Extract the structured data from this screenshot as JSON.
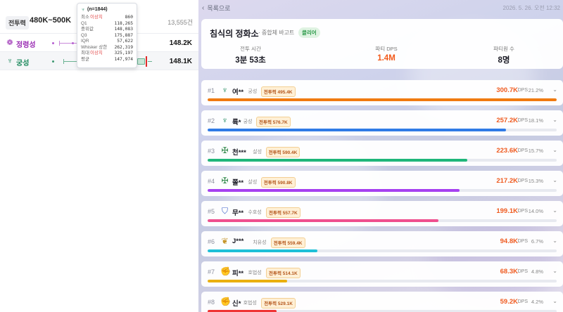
{
  "left": {
    "filter": {
      "chip": "전투력",
      "range": "480K~500K",
      "count": "13,555건"
    },
    "classes": [
      {
        "name": "정령성",
        "icon": "spirit-icon",
        "value": "148.2K",
        "color": "#9b2fb4"
      },
      {
        "name": "궁성",
        "icon": "bow-icon",
        "value": "148.1K",
        "color": "#1f8a5e"
      }
    ],
    "tooltip": {
      "header": "(n=1844)",
      "rows": [
        {
          "label": "최소",
          "outlier": "이상치",
          "value": "860"
        },
        {
          "label": "Q1",
          "outlier": "",
          "value": "118,265"
        },
        {
          "label": "중위값",
          "outlier": "",
          "value": "148,083"
        },
        {
          "label": "Q3",
          "outlier": "",
          "value": "175,887"
        },
        {
          "label": "IQR",
          "outlier": "",
          "value": "57,622"
        },
        {
          "label": "Whisker 상한",
          "outlier": "",
          "value": "262,319"
        },
        {
          "label": "최대",
          "outlier": "이상치",
          "value": "325,197"
        },
        {
          "label": "평균",
          "outlier": "",
          "value": "147,974"
        }
      ]
    }
  },
  "right": {
    "back": "목록으로",
    "datetime": "2026. 5. 26. 오전 12:32",
    "summary": {
      "title": "침식의 정화소",
      "subtitle": "· 중합체 바고트",
      "badge": "클리어",
      "stats": [
        {
          "label": "전투 시간",
          "value": "3분 53초"
        },
        {
          "label": "파티 DPS",
          "value": "1.4M"
        },
        {
          "label": "파티원 수",
          "value": "8명"
        }
      ]
    },
    "players": [
      {
        "rank": "#1",
        "name": "여**",
        "class": "궁성",
        "icon": "bow-icon",
        "cp": "전투력 495.4K",
        "dps": "300.7K",
        "unit": "DPS",
        "pct": "21.2%",
        "ratio": 1.0,
        "color": "#f07a10"
      },
      {
        "rank": "#2",
        "name": "륙*",
        "class": "궁성",
        "icon": "bow-icon",
        "cp": "전투력 576.7K",
        "dps": "257.2K",
        "unit": "DPS",
        "pct": "18.1%",
        "ratio": 0.855,
        "color": "#2f7be6"
      },
      {
        "rank": "#3",
        "name": "천***",
        "class": "살성",
        "icon": "blade-icon",
        "cp": "전투력 590.4K",
        "dps": "223.6K",
        "unit": "DPS",
        "pct": "15.7%",
        "ratio": 0.744,
        "color": "#1fb67a"
      },
      {
        "rank": "#4",
        "name": "쫄**",
        "class": "살성",
        "icon": "blade-icon",
        "cp": "전투력 590.8K",
        "dps": "217.2K",
        "unit": "DPS",
        "pct": "15.3%",
        "ratio": 0.722,
        "color": "#a640f0"
      },
      {
        "rank": "#5",
        "name": "무**",
        "class": "수호성",
        "icon": "shield-icon",
        "cp": "전투력 557.7K",
        "dps": "199.1K",
        "unit": "DPS",
        "pct": "14.0%",
        "ratio": 0.662,
        "color": "#ef4f8e"
      },
      {
        "rank": "#6",
        "name": "J***",
        "class": "치유성",
        "icon": "wing-icon",
        "cp": "전투력 559.4K",
        "dps": "94.8K",
        "unit": "DPS",
        "pct": "6.7%",
        "ratio": 0.315,
        "color": "#1ec0d8"
      },
      {
        "rank": "#7",
        "name": "피**",
        "class": "호법성",
        "icon": "fist-icon",
        "cp": "전투력 514.1K",
        "dps": "68.3K",
        "unit": "DPS",
        "pct": "4.8%",
        "ratio": 0.227,
        "color": "#eab00f"
      },
      {
        "rank": "#8",
        "name": "신*",
        "class": "호법성",
        "icon": "fist-icon",
        "cp": "전투력 529.1K",
        "dps": "59.2K",
        "unit": "DPS",
        "pct": "4.2%",
        "ratio": 0.197,
        "color": "#ef3434"
      }
    ]
  }
}
